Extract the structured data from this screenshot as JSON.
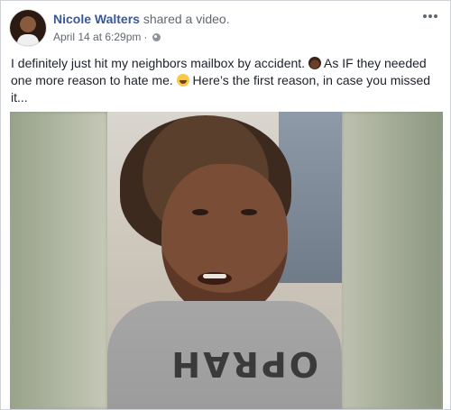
{
  "post": {
    "author": "Nicole Walters",
    "action": " shared a video.",
    "date": "April 14 at 6:29pm",
    "separator": "·",
    "text": {
      "part1": "I definitely just hit my neighbors mailbox by accident. ",
      "part2": " As IF they needed one more reason to hate me. ",
      "part3": " Here’s the first reason, in case you missed it..."
    },
    "icons": {
      "privacy": "globe-icon",
      "menu": "more-options-icon",
      "emoji_1": "woman-facepalming-emoji",
      "emoji_2": "laughing-emoji"
    }
  },
  "video": {
    "shirt_text": "OPRAH"
  },
  "colors": {
    "author_link": "#385898",
    "secondary_text": "#616770",
    "body_text": "#1d2129"
  }
}
